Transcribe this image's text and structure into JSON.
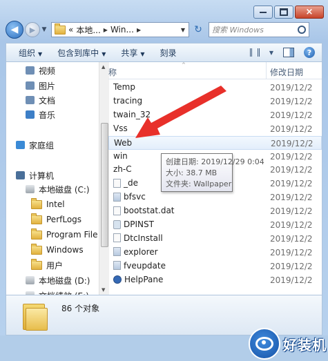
{
  "window": {
    "caption_buttons": [
      "minimize",
      "maximize",
      "close"
    ],
    "close_glyph": "×"
  },
  "nav": {
    "back_glyph": "◀",
    "forward_glyph": "▶",
    "breadcrumb": [
      "«",
      "本地...",
      "Win..."
    ],
    "search_placeholder": "搜索 Windows"
  },
  "toolbar": {
    "items": [
      "组织",
      "包含到库中",
      "共享",
      "刻录"
    ],
    "help_glyph": "?"
  },
  "sidebar": {
    "items": [
      {
        "label": "视频",
        "icon": "video-icon",
        "level": 1
      },
      {
        "label": "图片",
        "icon": "pictures-icon",
        "level": 1
      },
      {
        "label": "文档",
        "icon": "document-icon",
        "level": 1
      },
      {
        "label": "音乐",
        "icon": "music-icon",
        "level": 1
      },
      {
        "label": "家庭组",
        "icon": "homegroup-icon",
        "level": 0
      },
      {
        "label": "计算机",
        "icon": "computer-icon",
        "level": 0
      },
      {
        "label": "本地磁盘 (C:)",
        "icon": "drive-icon",
        "level": 1
      },
      {
        "label": "Intel",
        "icon": "folder-icon",
        "level": 2
      },
      {
        "label": "PerfLogs",
        "icon": "folder-icon",
        "level": 2
      },
      {
        "label": "Program File",
        "icon": "folder-icon",
        "level": 2
      },
      {
        "label": "Windows",
        "icon": "folder-icon",
        "level": 2,
        "selected": true
      },
      {
        "label": "用户",
        "icon": "folder-icon",
        "level": 2
      },
      {
        "label": "本地磁盘 (D:)",
        "icon": "drive-icon",
        "level": 1
      },
      {
        "label": "文档绩效 (E:)",
        "icon": "drive-icon",
        "level": 1
      }
    ]
  },
  "columns": {
    "name": "称",
    "date": "修改日期"
  },
  "files": [
    {
      "name": "Temp",
      "date": "2019/12/2",
      "type": "folder"
    },
    {
      "name": "tracing",
      "date": "2019/12/2",
      "type": "folder"
    },
    {
      "name": "twain_32",
      "date": "2019/12/2",
      "type": "folder"
    },
    {
      "name": "Vss",
      "date": "2019/12/2",
      "type": "folder"
    },
    {
      "name": "Web",
      "date": "2019/12/2",
      "type": "folder",
      "hover": true
    },
    {
      "name": "win",
      "date": "2019/12/2",
      "type": "folder"
    },
    {
      "name": "zh-C",
      "date": "2019/12/2",
      "type": "folder"
    },
    {
      "name": "_de",
      "date": "2019/12/2",
      "type": "file"
    },
    {
      "name": "bfsvc",
      "date": "2019/12/2",
      "type": "app"
    },
    {
      "name": "bootstat.dat",
      "date": "2019/12/2",
      "type": "file"
    },
    {
      "name": "DPINST",
      "date": "2019/12/2",
      "type": "gear"
    },
    {
      "name": "DtcInstall",
      "date": "2019/12/2",
      "type": "file"
    },
    {
      "name": "explorer",
      "date": "2019/12/2",
      "type": "app"
    },
    {
      "name": "fveupdate",
      "date": "2019/12/2",
      "type": "app"
    },
    {
      "name": "HelpPane",
      "date": "2019/12/2",
      "type": "help"
    }
  ],
  "tooltip": {
    "line1": "创建日期: 2019/12/29 0:04",
    "line2": "大小: 38.7 MB",
    "line3": "文件夹: Wallpaper"
  },
  "details": {
    "count": "86 个对象"
  },
  "watermark": {
    "text": "好装机"
  },
  "colors": {
    "arrow": "#e8302a",
    "accent": "#2c6fbf",
    "window_frame": "#b8d2ee"
  }
}
